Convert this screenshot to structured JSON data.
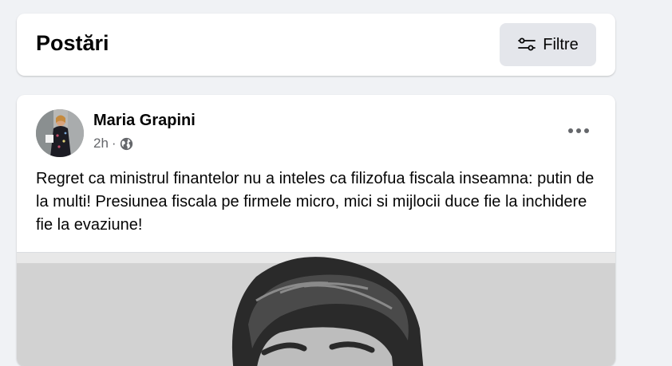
{
  "posts_header": {
    "title": "Postări",
    "filters_label": "Filtre",
    "filters_icon": "sliders-icon"
  },
  "post": {
    "author": "Maria Grapini",
    "time": "2h",
    "separator": "·",
    "audience_icon": "globe-icon",
    "more_icon": "more-horizontal-icon",
    "text": "Regret ca ministrul finantelor nu a inteles ca filizofua fiscala inseamna: putin de la multi! Presiunea fiscala pe firmele micro, mici si mijlocii duce fie la inchidere fie la evaziune!",
    "image": "black-and-white-portrait-photo"
  },
  "colors": {
    "page_bg": "#f0f2f5",
    "card_bg": "#ffffff",
    "button_bg": "#e4e6eb",
    "text_primary": "#050505",
    "text_secondary": "#65676b"
  }
}
